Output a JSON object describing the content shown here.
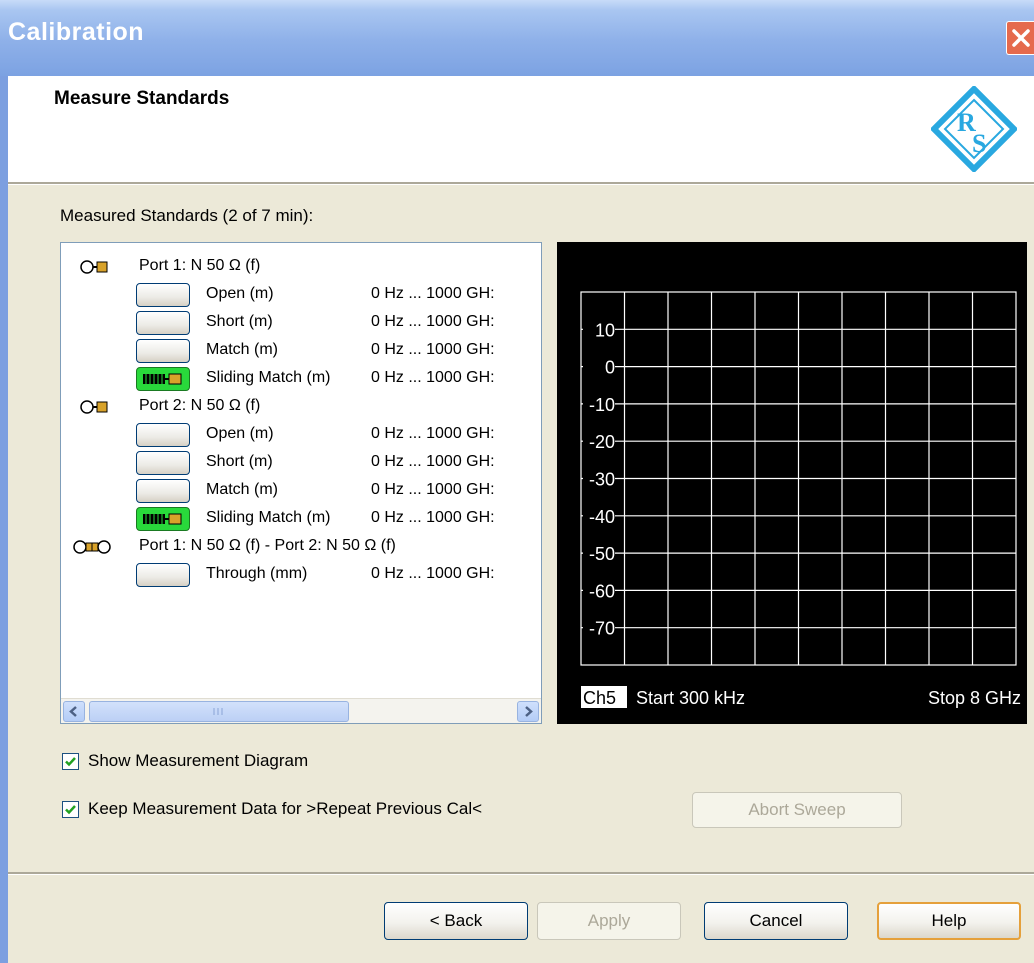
{
  "window": {
    "title": "Calibration"
  },
  "header": {
    "title": "Measure Standards"
  },
  "standards": {
    "heading": "Measured Standards (2 of 7 min):",
    "rows": [
      {
        "kind": "port",
        "label": "Port 1: N 50 Ω (f)",
        "icon": "port-connector-icon"
      },
      {
        "kind": "std",
        "name": "Open (m)",
        "range": "0 Hz ... 1000 GH:",
        "measured": false
      },
      {
        "kind": "std",
        "name": "Short (m)",
        "range": "0 Hz ... 1000 GH:",
        "measured": false
      },
      {
        "kind": "std",
        "name": "Match (m)",
        "range": "0 Hz ... 1000 GH:",
        "measured": false
      },
      {
        "kind": "std",
        "name": "Sliding Match (m)",
        "range": "0 Hz ... 1000 GH:",
        "measured": true
      },
      {
        "kind": "port",
        "label": "Port 2: N 50 Ω (f)",
        "icon": "port-connector-icon"
      },
      {
        "kind": "std",
        "name": "Open (m)",
        "range": "0 Hz ... 1000 GH:",
        "measured": false
      },
      {
        "kind": "std",
        "name": "Short (m)",
        "range": "0 Hz ... 1000 GH:",
        "measured": false
      },
      {
        "kind": "std",
        "name": "Match (m)",
        "range": "0 Hz ... 1000 GH:",
        "measured": false
      },
      {
        "kind": "std",
        "name": "Sliding Match (m)",
        "range": "0 Hz ... 1000 GH:",
        "measured": true
      },
      {
        "kind": "port",
        "label": "Port 1: N 50 Ω (f) - Port 2: N 50 Ω (f)",
        "icon": "through-connector-icon"
      },
      {
        "kind": "std",
        "name": "Through (mm)",
        "range": "0 Hz ... 1000 GH:",
        "measured": false
      }
    ]
  },
  "diagram": {
    "y_ticks": [
      "10",
      "0",
      "-10",
      "-20",
      "-30",
      "-40",
      "-50",
      "-60",
      "-70"
    ],
    "channel": "Ch5",
    "start": "Start 300 kHz",
    "stop": "Stop 8 GHz"
  },
  "options": {
    "show_diagram": {
      "label": "Show Measurement Diagram",
      "checked": true
    },
    "keep_data": {
      "label": "Keep Measurement Data for >Repeat Previous Cal<",
      "checked": true
    },
    "abort_label": "Abort Sweep"
  },
  "footer": {
    "back": "< Back",
    "apply": "Apply",
    "cancel": "Cancel",
    "help": "Help"
  },
  "colors": {
    "title_bar": "#7ca2e2",
    "close": "#e56a4d",
    "measured": "#29d93b",
    "logo": "#29a8e0"
  }
}
